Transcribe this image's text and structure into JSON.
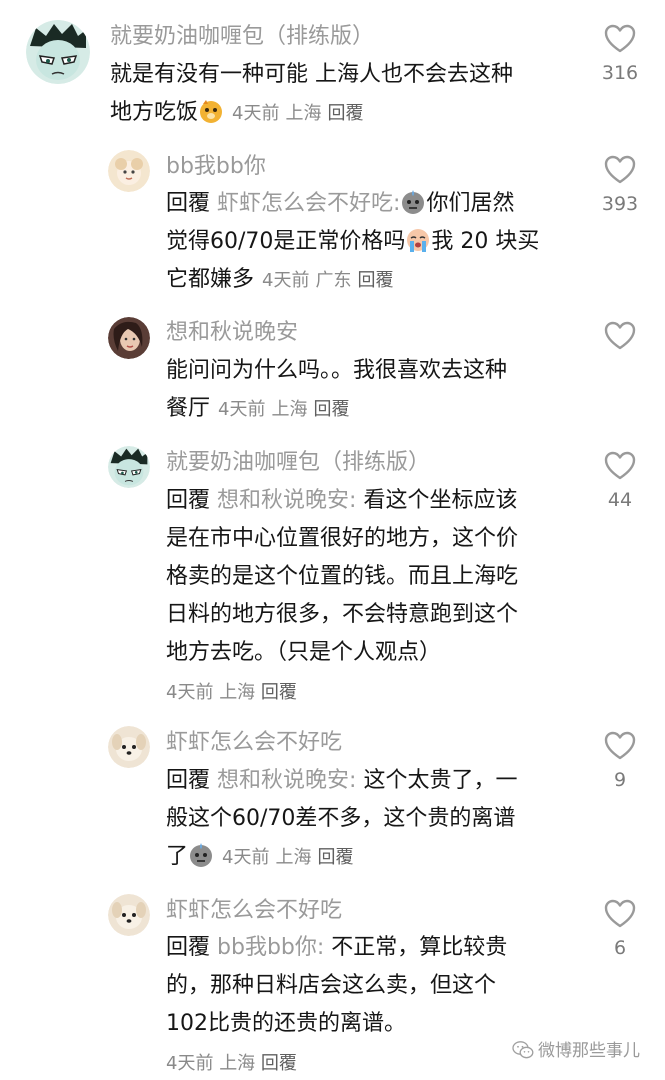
{
  "comments": [
    {
      "username": "就要奶油咖喱包（排练版）",
      "lines": [
        "就是有没有一种可能 上海人也不会去这种",
        "地方吃饭"
      ],
      "time": "4天前",
      "location": "上海",
      "reply_label": "回覆",
      "likes": "316",
      "avatar_icon": "cartoon-face-icon",
      "emoji_icon": "squirrel-face-emoji-icon"
    },
    {
      "username": "bb我bb你",
      "reply_prefix": "回覆",
      "reply_target": "虾虾怎么会不好吃:",
      "lines": [
        "你们居然",
        "觉得60/70是正常价格吗",
        "我 20 块买",
        "它都嫌多"
      ],
      "time": "4天前",
      "location": "广东",
      "reply_label": "回覆",
      "likes": "393",
      "avatar_icon": "cartoon-avatar-icon",
      "emoji_icons": [
        "sweat-face-emoji-icon",
        "crying-face-emoji-icon"
      ]
    },
    {
      "username": "想和秋说晚安",
      "lines": [
        "能问问为什么吗。。我很喜欢去这种",
        "餐厅"
      ],
      "time": "4天前",
      "location": "上海",
      "reply_label": "回覆",
      "likes": "",
      "avatar_icon": "photo-avatar-icon"
    },
    {
      "username": "就要奶油咖喱包（排练版）",
      "reply_prefix": "回覆",
      "reply_target": "想和秋说晚安:",
      "lines": [
        "看这个坐标应该",
        "是在市中心位置很好的地方，这个价",
        "格卖的是这个位置的钱。而且上海吃",
        "日料的地方很多，不会特意跑到这个",
        "地方去吃。（只是个人观点）"
      ],
      "time": "4天前",
      "location": "上海",
      "reply_label": "回覆",
      "likes": "44",
      "avatar_icon": "cartoon-face-icon"
    },
    {
      "username": "虾虾怎么会不好吃",
      "reply_prefix": "回覆",
      "reply_target": "想和秋说晚安:",
      "lines": [
        "这个太贵了，一",
        "般这个60/70差不多，这个贵的离谱",
        "了"
      ],
      "time": "4天前",
      "location": "上海",
      "reply_label": "回覆",
      "likes": "9",
      "avatar_icon": "puppy-avatar-icon",
      "emoji_icon": "sweat-face-emoji-icon"
    },
    {
      "username": "虾虾怎么会不好吃",
      "reply_prefix": "回覆",
      "reply_target": "bb我bb你:",
      "lines": [
        "不正常，算比较贵",
        "的，那种日料店会这么卖，但这个",
        "102比贵的还贵的离谱。"
      ],
      "time": "4天前",
      "location": "上海",
      "reply_label": "回覆",
      "likes": "6",
      "avatar_icon": "puppy-avatar-icon"
    }
  ],
  "watermark": {
    "text": "微博那些事儿",
    "icon": "wechat-icon"
  },
  "colors": {
    "username": "#9a9a9a",
    "text": "#161616",
    "meta": "#8a8a8a",
    "heart": "#9a9a9a"
  }
}
